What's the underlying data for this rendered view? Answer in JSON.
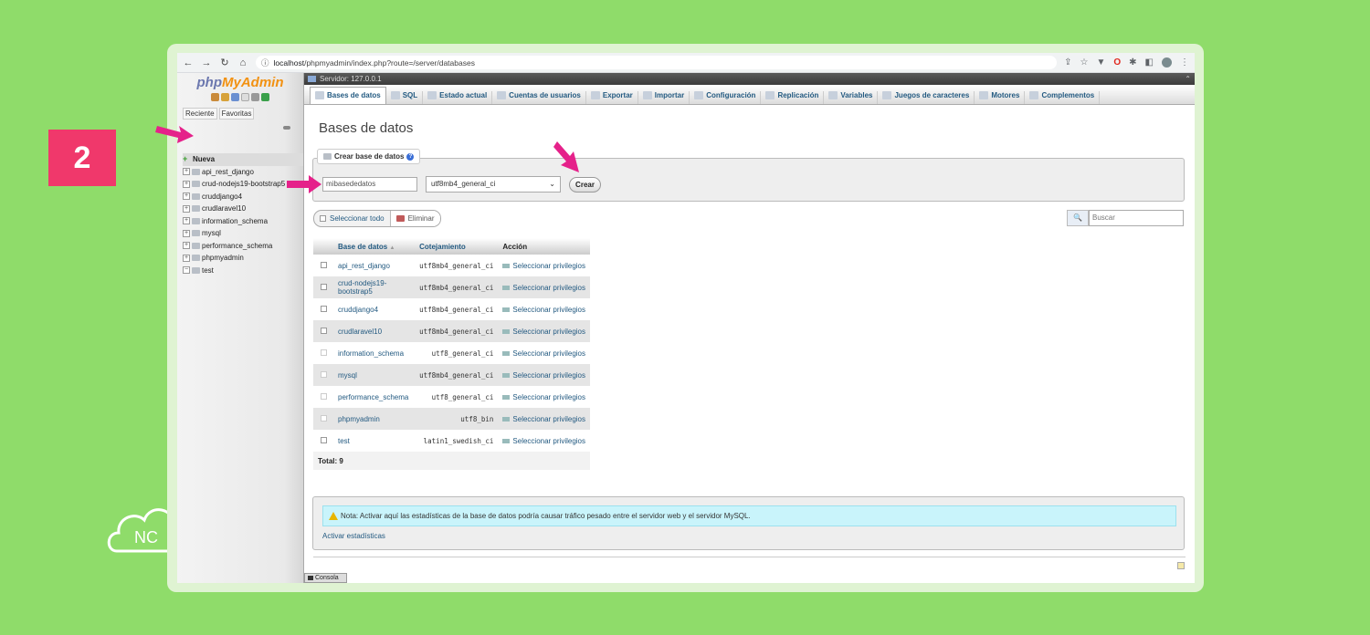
{
  "overlay": {
    "step_number": "2",
    "logo_text": "NC",
    "arrow_color": "#e5218a"
  },
  "browser": {
    "url_host": "localhost",
    "url_path": "/phpmyadmin/index.php?route=/server/databases"
  },
  "nav": {
    "logo_php": "php",
    "logo_my": "MyAdmin",
    "recent_label": "Reciente",
    "favorites_label": "Favoritas",
    "new_label": "Nueva",
    "databases": [
      "api_rest_django",
      "crud-nodejs19-bootstrap5",
      "cruddjango4",
      "crudlaravel10",
      "information_schema",
      "mysql",
      "performance_schema",
      "phpmyadmin",
      "test"
    ]
  },
  "server_bar": {
    "label": "Servidor: 127.0.0.1"
  },
  "tabs": [
    {
      "label": "Bases de datos",
      "icon": "database-icon"
    },
    {
      "label": "SQL",
      "icon": "sql-icon"
    },
    {
      "label": "Estado actual",
      "icon": "status-icon"
    },
    {
      "label": "Cuentas de usuarios",
      "icon": "users-icon"
    },
    {
      "label": "Exportar",
      "icon": "export-icon"
    },
    {
      "label": "Importar",
      "icon": "import-icon"
    },
    {
      "label": "Configuración",
      "icon": "settings-icon"
    },
    {
      "label": "Replicación",
      "icon": "replication-icon"
    },
    {
      "label": "Variables",
      "icon": "variables-icon"
    },
    {
      "label": "Juegos de caracteres",
      "icon": "charset-icon"
    },
    {
      "label": "Motores",
      "icon": "engines-icon"
    },
    {
      "label": "Complementos",
      "icon": "plugins-icon"
    }
  ],
  "main": {
    "page_title": "Bases de datos",
    "create_legend": "Crear base de datos",
    "dbname_value": "mibasededatos",
    "collation_value": "utf8mb4_general_ci",
    "create_button": "Crear",
    "select_all": "Seleccionar todo",
    "delete_button": "Eliminar",
    "search_placeholder": "Buscar",
    "table_headers": {
      "name": "Base de datos",
      "sort": "▲",
      "collation": "Cotejamiento",
      "action": "Acción"
    },
    "rows": [
      {
        "name": "api_rest_django",
        "collation": "utf8mb4_general_ci",
        "action": "Seleccionar privilegios",
        "checkbox_enabled": true
      },
      {
        "name": "crud-nodejs19-bootstrap5",
        "collation": "utf8mb4_general_ci",
        "action": "Seleccionar privilegios",
        "checkbox_enabled": true
      },
      {
        "name": "cruddjango4",
        "collation": "utf8mb4_general_ci",
        "action": "Seleccionar privilegios",
        "checkbox_enabled": true
      },
      {
        "name": "crudlaravel10",
        "collation": "utf8mb4_general_ci",
        "action": "Seleccionar privilegios",
        "checkbox_enabled": true
      },
      {
        "name": "information_schema",
        "collation": "utf8_general_ci",
        "action": "Seleccionar privilegios",
        "checkbox_enabled": false
      },
      {
        "name": "mysql",
        "collation": "utf8mb4_general_ci",
        "action": "Seleccionar privilegios",
        "checkbox_enabled": false
      },
      {
        "name": "performance_schema",
        "collation": "utf8_general_ci",
        "action": "Seleccionar privilegios",
        "checkbox_enabled": false
      },
      {
        "name": "phpmyadmin",
        "collation": "utf8_bin",
        "action": "Seleccionar privilegios",
        "checkbox_enabled": false
      },
      {
        "name": "test",
        "collation": "latin1_swedish_ci",
        "action": "Seleccionar privilegios",
        "checkbox_enabled": true
      }
    ],
    "total_label": "Total: 9",
    "notice_text": "Nota: Activar aquí las estadísticas de la base de datos podría causar tráfico pesado entre el servidor web y el servidor MySQL.",
    "activate_stats": "Activar estadísticas",
    "console_label": "Consola"
  }
}
